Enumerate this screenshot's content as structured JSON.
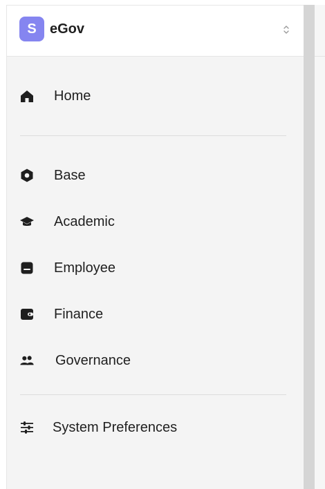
{
  "app": {
    "logo_letter": "S",
    "name": "eGov",
    "accent_color": "#8585f0"
  },
  "nav": {
    "home": {
      "label": "Home",
      "icon": "home-icon"
    },
    "items": [
      {
        "label": "Base",
        "icon": "hexagon-icon"
      },
      {
        "label": "Academic",
        "icon": "graduation-cap-icon"
      },
      {
        "label": "Employee",
        "icon": "id-card-icon"
      },
      {
        "label": "Finance",
        "icon": "wallet-icon"
      },
      {
        "label": "Governance",
        "icon": "users-icon"
      }
    ],
    "preferences": {
      "label": "System Preferences",
      "icon": "sliders-icon"
    }
  }
}
